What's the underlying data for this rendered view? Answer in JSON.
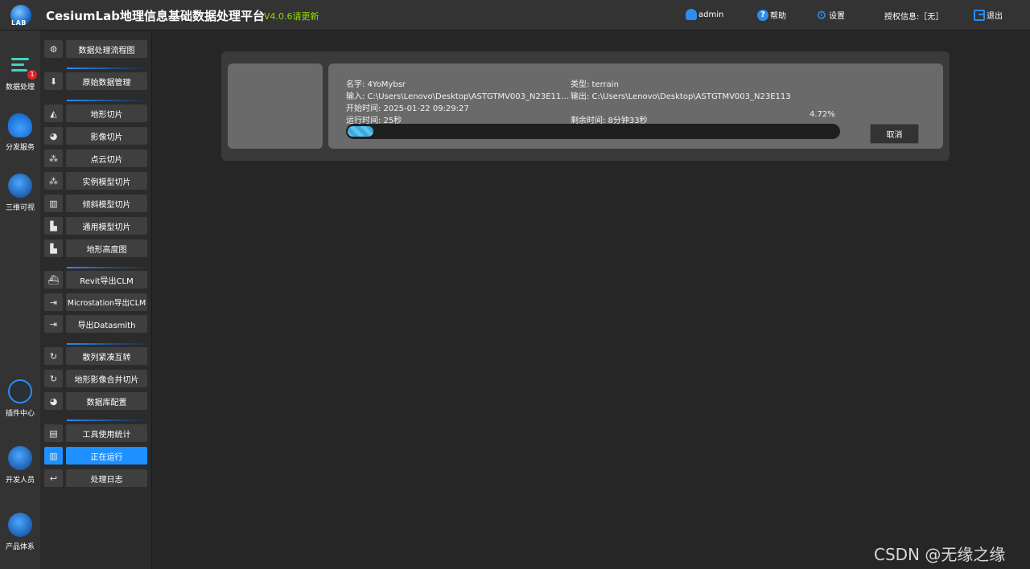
{
  "header": {
    "logo_text": "LAB",
    "title": "CesiumLab地理信息基础数据处理平台",
    "version": "V4.0.6请更新",
    "user": "admin",
    "help": "帮助",
    "settings": "设置",
    "license": "授权信息:［无］",
    "logout": "退出"
  },
  "leftnav": [
    {
      "label": "数据处理",
      "icon": "data-process-icon",
      "badge": "1"
    },
    {
      "label": "分发服务",
      "icon": "cloud-icon"
    },
    {
      "label": "三维可视",
      "icon": "earth-icon"
    },
    {
      "label": "插件中心",
      "icon": "plugin-icon"
    },
    {
      "label": "开发人员",
      "icon": "earth-icon"
    },
    {
      "label": "产品体系",
      "icon": "earth-icon"
    }
  ],
  "menu": [
    {
      "label": "数据处理流程图",
      "icon": "⚙"
    },
    {
      "label": "原始数据管理",
      "icon": "⬇"
    },
    {
      "label": "地形切片",
      "icon": "◭"
    },
    {
      "label": "影像切片",
      "icon": "◕"
    },
    {
      "label": "点云切片",
      "icon": "⁂"
    },
    {
      "label": "实例模型切片",
      "icon": "⁂"
    },
    {
      "label": "倾斜模型切片",
      "icon": "▥"
    },
    {
      "label": "通用模型切片",
      "icon": "▙"
    },
    {
      "label": "地形高度图",
      "icon": "▙"
    },
    {
      "label": "Revit导出CLM",
      "icon": "⛴"
    },
    {
      "label": "Microstation导出CLM",
      "icon": "⇥"
    },
    {
      "label": "导出Datasmith",
      "icon": "⇥"
    },
    {
      "label": "散列紧凑互转",
      "icon": "↻"
    },
    {
      "label": "地形影像合并切片",
      "icon": "↻"
    },
    {
      "label": "数据库配置",
      "icon": "◕"
    },
    {
      "label": "工具使用统计",
      "icon": "▤"
    },
    {
      "label": "正在运行",
      "icon": "▥"
    },
    {
      "label": "处理日志",
      "icon": "↩"
    }
  ],
  "task": {
    "name": "名字: 4YoMybsr",
    "type": "类型: terrain",
    "input": "输入: C:\\Users\\Lenovo\\Desktop\\ASTGTMV003_N23E113...",
    "output": "输出: C:\\Users\\Lenovo\\Desktop\\ASTGTMV003_N23E113",
    "start_time": "开始时间: 2025-01-22 09:29:27",
    "run_time": "运行时间: 25秒",
    "remaining": "剩余时间: 8分钟33秒",
    "percent": "4.72%",
    "progress": 0.0472,
    "cancel": "取消"
  },
  "watermark": "CSDN @无缘之缘"
}
